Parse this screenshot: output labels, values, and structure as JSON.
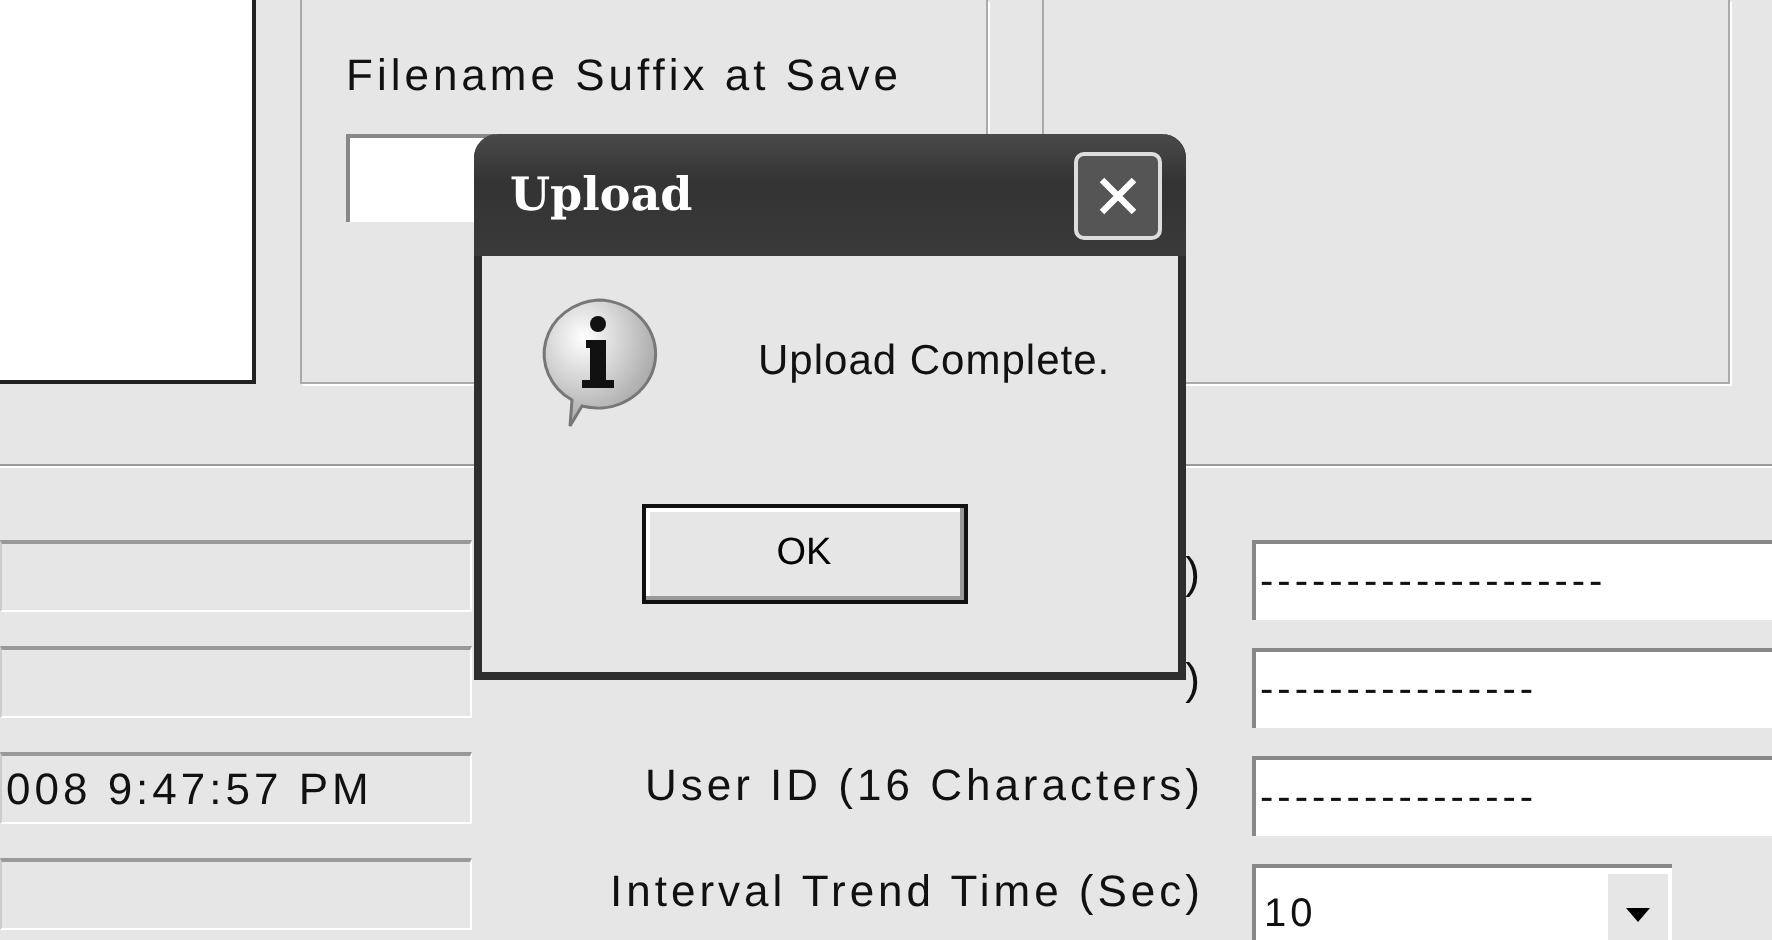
{
  "filename_suffix": {
    "label": "Filename Suffix at Save"
  },
  "settings": [
    {
      "kind": "text",
      "label": ")",
      "value": "--------------------"
    },
    {
      "kind": "text",
      "label": ")",
      "value": "----------------"
    },
    {
      "kind": "text",
      "status_text": "008 9:47:57 PM",
      "label": "User ID (16 Characters)",
      "value": "----------------"
    },
    {
      "kind": "dropdown",
      "label": "Interval Trend Time (Sec)",
      "value": "10"
    }
  ],
  "dialog": {
    "title": "Upload",
    "message": "Upload Complete.",
    "buttons": [
      "OK"
    ]
  }
}
